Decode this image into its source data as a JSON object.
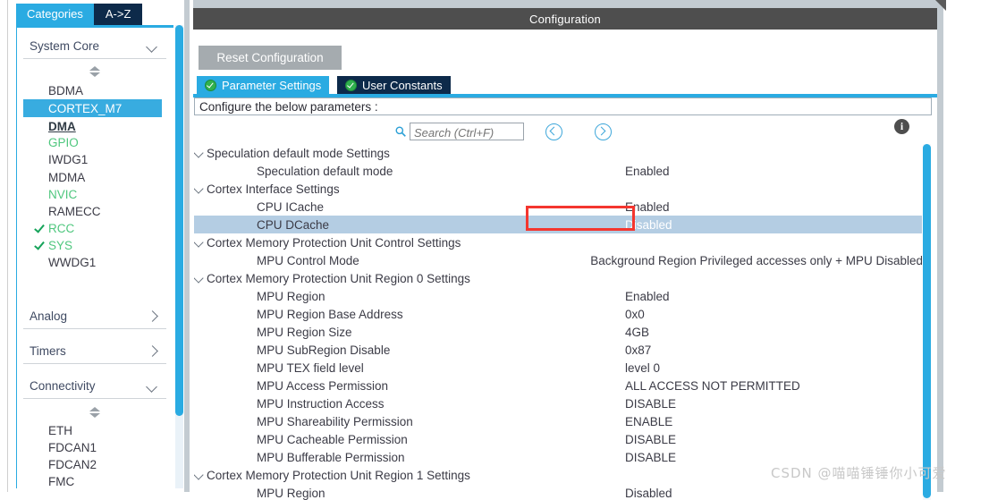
{
  "window": {
    "config_header": "Configuration",
    "watermark": "CSDN @喵喵锤锤你小可爱"
  },
  "sidebar": {
    "tabs": [
      {
        "label": "Categories",
        "active": true
      },
      {
        "label": "A->Z",
        "active": false
      }
    ],
    "groups": [
      {
        "label": "System Core",
        "expanded": true,
        "items": [
          {
            "label": "BDMA",
            "state": "normal"
          },
          {
            "label": "CORTEX_M7",
            "state": "selected"
          },
          {
            "label": "DMA",
            "state": "configured-bold"
          },
          {
            "label": "GPIO",
            "state": "green"
          },
          {
            "label": "IWDG1",
            "state": "normal"
          },
          {
            "label": "MDMA",
            "state": "normal"
          },
          {
            "label": "NVIC",
            "state": "green"
          },
          {
            "label": "RAMECC",
            "state": "normal"
          },
          {
            "label": "RCC",
            "state": "green-check"
          },
          {
            "label": "SYS",
            "state": "green-check"
          },
          {
            "label": "WWDG1",
            "state": "normal"
          }
        ]
      },
      {
        "label": "Analog",
        "expanded": false,
        "items": []
      },
      {
        "label": "Timers",
        "expanded": false,
        "items": []
      },
      {
        "label": "Connectivity",
        "expanded": true,
        "items": [
          {
            "label": "ETH",
            "state": "normal"
          },
          {
            "label": "FDCAN1",
            "state": "normal"
          },
          {
            "label": "FDCAN2",
            "state": "normal"
          },
          {
            "label": "FMC",
            "state": "normal"
          }
        ]
      }
    ]
  },
  "main": {
    "reset_button": "Reset Configuration",
    "tabs": [
      {
        "label": "Parameter Settings",
        "active": true
      },
      {
        "label": "User Constants",
        "active": false
      }
    ],
    "configure_line": "Configure the below parameters :",
    "search": {
      "placeholder": "Search (Ctrl+F)",
      "value": ""
    },
    "rows": [
      {
        "type": "group",
        "label": "Speculation default mode Settings",
        "value": ""
      },
      {
        "type": "leaf",
        "label": "Speculation default mode",
        "value": "Enabled"
      },
      {
        "type": "group",
        "label": "Cortex Interface Settings",
        "value": ""
      },
      {
        "type": "leaf",
        "label": "CPU ICache",
        "value": "Enabled"
      },
      {
        "type": "leaf",
        "label": "CPU DCache",
        "value": "Disabled",
        "highlighted": true
      },
      {
        "type": "group",
        "label": "Cortex Memory Protection Unit Control Settings",
        "value": ""
      },
      {
        "type": "leaf",
        "label": "MPU Control Mode",
        "value": "Background Region Privileged accesses only + MPU Disabled duri..."
      },
      {
        "type": "group",
        "label": "Cortex Memory Protection Unit Region 0 Settings",
        "value": ""
      },
      {
        "type": "leaf",
        "label": "MPU Region",
        "value": "Enabled"
      },
      {
        "type": "leaf",
        "label": "MPU Region Base Address",
        "value": "0x0"
      },
      {
        "type": "leaf",
        "label": "MPU Region Size",
        "value": "4GB"
      },
      {
        "type": "leaf",
        "label": "MPU SubRegion Disable",
        "value": "0x87"
      },
      {
        "type": "leaf",
        "label": "MPU TEX field level",
        "value": "level 0"
      },
      {
        "type": "leaf",
        "label": "MPU Access Permission",
        "value": "ALL ACCESS NOT PERMITTED"
      },
      {
        "type": "leaf",
        "label": "MPU Instruction Access",
        "value": "DISABLE"
      },
      {
        "type": "leaf",
        "label": "MPU Shareability Permission",
        "value": "ENABLE"
      },
      {
        "type": "leaf",
        "label": "MPU Cacheable Permission",
        "value": "DISABLE"
      },
      {
        "type": "leaf",
        "label": "MPU Bufferable  Permission",
        "value": "DISABLE"
      },
      {
        "type": "group",
        "label": "Cortex Memory Protection Unit Region 1 Settings",
        "value": ""
      },
      {
        "type": "leaf",
        "label": "MPU Region",
        "value": "Disabled"
      }
    ],
    "info_icon_label": "i"
  },
  "colors": {
    "accent": "#2aabe2",
    "tab_dark": "#0d2a4a",
    "header_bar": "#4e4e4e",
    "row_highlight": "#b4cde3",
    "annotation_red": "#f4362f",
    "configured_green": "#4fc77e",
    "check_green": "#16a35a"
  }
}
